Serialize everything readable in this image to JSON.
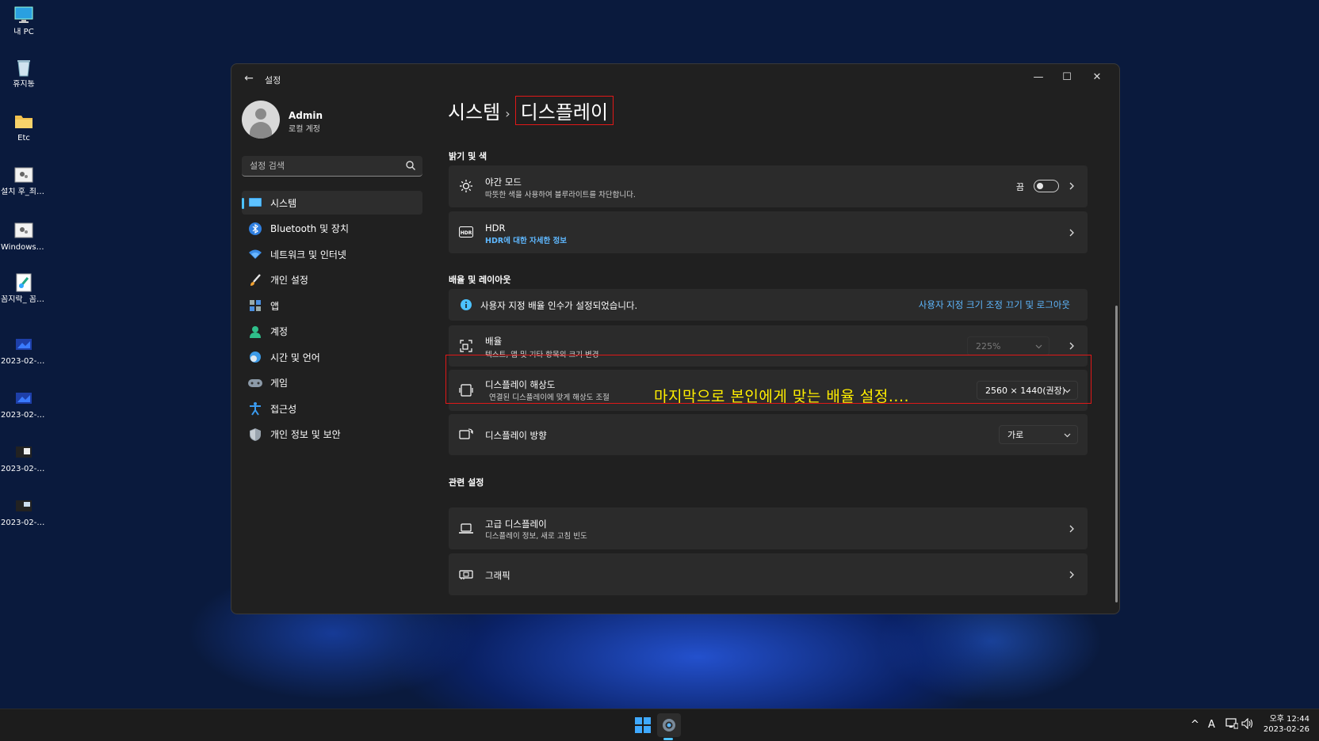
{
  "desktop": {
    "icons": [
      {
        "label": "내 PC",
        "icon": "monitor-icon"
      },
      {
        "label": "휴지통",
        "icon": "recycle-bin-icon"
      },
      {
        "label": "Etc",
        "icon": "folder-icon"
      },
      {
        "label": "설치 후_최적화.c...",
        "icon": "settings-file-icon"
      },
      {
        "label": "Windows_...",
        "icon": "settings-file-icon"
      },
      {
        "label": "꼼지락_ 꼼지락...",
        "icon": "shortcut-icon"
      },
      {
        "label": "2023-02-2...",
        "icon": "image-icon"
      },
      {
        "label": "2023-02-2...",
        "icon": "image-icon"
      },
      {
        "label": "2023-02-2...",
        "icon": "image-icon"
      },
      {
        "label": "2023-02-2...",
        "icon": "image-icon"
      }
    ]
  },
  "window": {
    "title": "설정",
    "controls": {
      "minimize": "—",
      "maximize": "☐",
      "close": "✕"
    },
    "user": {
      "name": "Admin",
      "type": "로컬 계정"
    },
    "search": {
      "placeholder": "설정 검색",
      "value": ""
    },
    "nav": [
      {
        "label": "시스템",
        "icon": "system-icon",
        "active": true
      },
      {
        "label": "Bluetooth 및 장치",
        "icon": "bluetooth-icon"
      },
      {
        "label": "네트워크 및 인터넷",
        "icon": "wifi-icon"
      },
      {
        "label": "개인 설정",
        "icon": "brush-icon"
      },
      {
        "label": "앱",
        "icon": "apps-icon"
      },
      {
        "label": "계정",
        "icon": "account-icon"
      },
      {
        "label": "시간 및 언어",
        "icon": "clock-globe-icon"
      },
      {
        "label": "게임",
        "icon": "gamepad-icon"
      },
      {
        "label": "접근성",
        "icon": "accessibility-icon"
      },
      {
        "label": "개인 정보 및 보안",
        "icon": "shield-icon"
      }
    ],
    "breadcrumb": {
      "parent": "시스템",
      "separator": "›",
      "current": "디스플레이"
    },
    "sections": {
      "brightness": "밝기 및 색",
      "scale_layout": "배율 및 레이아웃",
      "related": "관련 설정"
    },
    "night_mode": {
      "title": "야간 모드",
      "subtitle": "따뜻한 색을 사용하여 블루라이트를 차단합니다.",
      "state_label": "끔",
      "on": false
    },
    "hdr": {
      "title": "HDR",
      "link": "HDR에 대한 자세한 정보"
    },
    "info_bar": {
      "text": "사용자 지정 배율 인수가 설정되었습니다.",
      "action": "사용자 지정 크기 조정 끄기 및 로그아웃"
    },
    "scale": {
      "title": "배율",
      "subtitle": "텍스트, 앱 및 기타 항목의 크기 변경",
      "value": "225%"
    },
    "resolution": {
      "title": "디스플레이 해상도",
      "subtitle": "연결된 디스플레이에 맞게 해상도 조절",
      "value": "2560 × 1440(권장)"
    },
    "orientation": {
      "title": "디스플레이 방향",
      "value": "가로"
    },
    "advanced": {
      "title": "고급 디스플레이",
      "subtitle": "디스플레이 정보, 새로 고침 빈도"
    },
    "graphics": {
      "title": "그래픽"
    },
    "annotation": "마지막으로 본인에게 맞는 배율 설정...."
  },
  "taskbar": {
    "tray": {
      "chevron": "^",
      "ime": "A"
    },
    "clock": {
      "time": "오후 12:44",
      "date": "2023-02-26"
    }
  },
  "colors": {
    "accent": "#4cc2ff",
    "highlight_box": "#e01818",
    "annotation": "#ffee00",
    "link": "#5fb8ff"
  }
}
